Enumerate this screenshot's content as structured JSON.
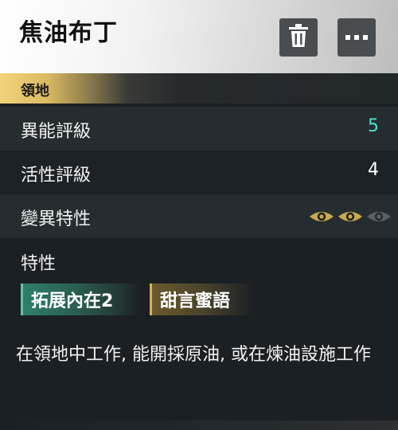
{
  "header": {
    "title": "焦油布丁"
  },
  "section": {
    "label": "領地"
  },
  "stats": [
    {
      "label": "異能評級",
      "value": "5"
    },
    {
      "label": "活性評級",
      "value": "4"
    },
    {
      "label": "變異特性",
      "filled_of_total": "2 of 3"
    }
  ],
  "traits": {
    "heading": "特性",
    "items": [
      {
        "label": "拓展內在2"
      },
      {
        "label": "甜言蜜語"
      }
    ]
  },
  "description": "在領地中工作, 能開採原油, 或在煉油設施工作",
  "colors": {
    "accent_value": "#4fe0cf",
    "gold": "#d8b451",
    "teal": "#2f7f6c"
  },
  "icons": {
    "delete": "trash-icon",
    "more": "more-horizontal-icon",
    "mutation": "eye-icon"
  }
}
